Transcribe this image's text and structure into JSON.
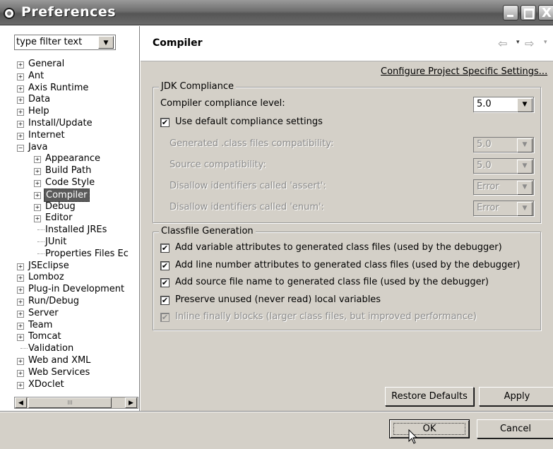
{
  "window": {
    "title": "Preferences"
  },
  "filter": {
    "placeholder": "type filter text",
    "arrow_icon": "▼"
  },
  "tree": [
    {
      "label": "General",
      "depth": 0,
      "expander": "+"
    },
    {
      "label": "Ant",
      "depth": 0,
      "expander": "+"
    },
    {
      "label": "Axis Runtime",
      "depth": 0,
      "expander": "+"
    },
    {
      "label": "Data",
      "depth": 0,
      "expander": "+"
    },
    {
      "label": "Help",
      "depth": 0,
      "expander": "+"
    },
    {
      "label": "Install/Update",
      "depth": 0,
      "expander": "+"
    },
    {
      "label": "Internet",
      "depth": 0,
      "expander": "+"
    },
    {
      "label": "Java",
      "depth": 0,
      "expander": "−"
    },
    {
      "label": "Appearance",
      "depth": 1,
      "expander": "+"
    },
    {
      "label": "Build Path",
      "depth": 1,
      "expander": "+"
    },
    {
      "label": "Code Style",
      "depth": 1,
      "expander": "+"
    },
    {
      "label": "Compiler",
      "depth": 1,
      "expander": "+",
      "selected": true
    },
    {
      "label": "Debug",
      "depth": 1,
      "expander": "+"
    },
    {
      "label": "Editor",
      "depth": 1,
      "expander": "+"
    },
    {
      "label": "Installed JREs",
      "depth": 1,
      "expander": ""
    },
    {
      "label": "JUnit",
      "depth": 1,
      "expander": ""
    },
    {
      "label": "Properties Files Ec",
      "depth": 1,
      "expander": ""
    },
    {
      "label": "JSEclipse",
      "depth": 0,
      "expander": "+"
    },
    {
      "label": "Lomboz",
      "depth": 0,
      "expander": "+"
    },
    {
      "label": "Plug-in Development",
      "depth": 0,
      "expander": "+"
    },
    {
      "label": "Run/Debug",
      "depth": 0,
      "expander": "+"
    },
    {
      "label": "Server",
      "depth": 0,
      "expander": "+"
    },
    {
      "label": "Team",
      "depth": 0,
      "expander": "+"
    },
    {
      "label": "Tomcat",
      "depth": 0,
      "expander": "+"
    },
    {
      "label": "Validation",
      "depth": 0,
      "expander": ""
    },
    {
      "label": "Web and XML",
      "depth": 0,
      "expander": "+"
    },
    {
      "label": "Web Services",
      "depth": 0,
      "expander": "+"
    },
    {
      "label": "XDoclet",
      "depth": 0,
      "expander": "+"
    }
  ],
  "scrollbar": {
    "left_icon": "◀",
    "thumb_grip": "III",
    "right_icon": "▶"
  },
  "page": {
    "title": "Compiler",
    "nav_back_icon": "⇦",
    "nav_forward_icon": "⇨",
    "nav_dropdown_icon": "▾",
    "configure_link": "Configure Project Specific Settings..."
  },
  "jdk": {
    "group_title": "JDK Compliance",
    "compliance_label": "Compiler compliance level:",
    "compliance_value": "5.0",
    "use_default_label": "Use default compliance settings",
    "use_default_checked": "✔",
    "rows": [
      {
        "label": "Generated .class files compatibility:",
        "value": "5.0"
      },
      {
        "label": "Source compatibility:",
        "value": "5.0"
      },
      {
        "label": "Disallow identifiers called 'assert':",
        "value": "Error"
      },
      {
        "label": "Disallow identifiers called 'enum':",
        "value": "Error"
      }
    ]
  },
  "classfile": {
    "group_title": "Classfile Generation",
    "options": [
      {
        "label": "Add variable attributes to generated class files (used by the debugger)",
        "checked": "✔",
        "enabled": true
      },
      {
        "label": "Add line number attributes to generated class files (used by the debugger)",
        "checked": "✔",
        "enabled": true
      },
      {
        "label": "Add source file name to generated class file (used by the debugger)",
        "checked": "✔",
        "enabled": true
      },
      {
        "label": "Preserve unused (never read) local variables",
        "checked": "✔",
        "enabled": true
      },
      {
        "label": "Inline finally blocks (larger class files, but improved performance)",
        "checked": "✔",
        "enabled": false
      }
    ]
  },
  "buttons": {
    "restore": "Restore Defaults",
    "apply": "Apply",
    "ok": "OK",
    "cancel": "Cancel"
  },
  "icons": {
    "combo_arrow": "▼",
    "close": "X"
  }
}
